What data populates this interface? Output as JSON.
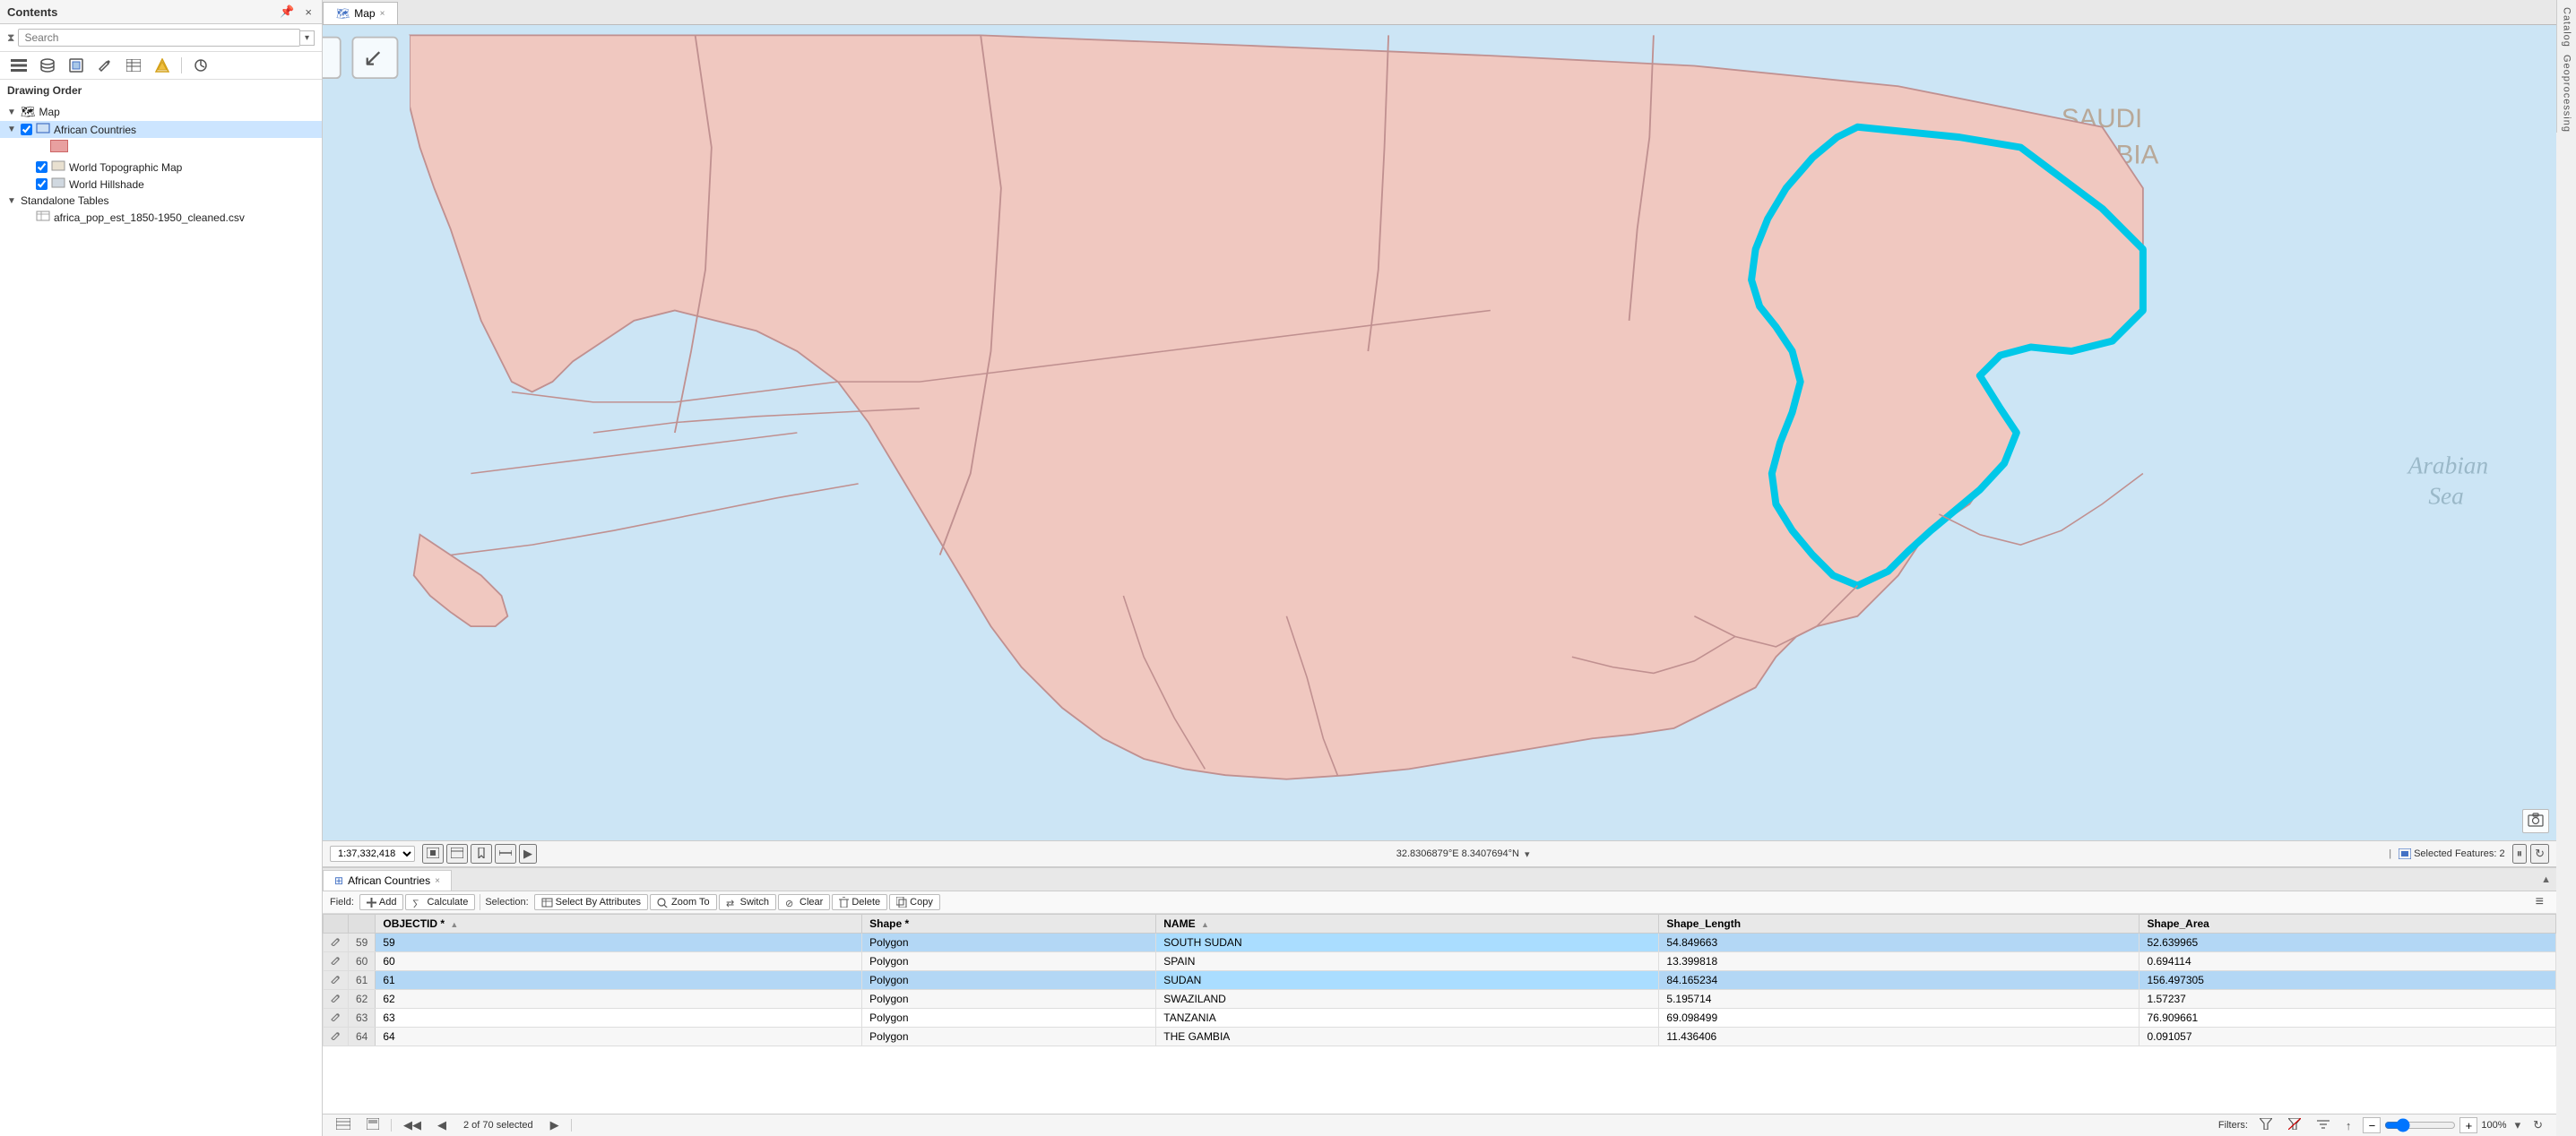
{
  "contents": {
    "title": "Contents",
    "search_placeholder": "Search",
    "drawing_order_label": "Drawing Order",
    "layers": [
      {
        "id": "map",
        "label": "Map",
        "type": "map",
        "indent": 0,
        "expanded": true
      },
      {
        "id": "african-countries",
        "label": "African Countries",
        "type": "feature",
        "indent": 1,
        "checked": true,
        "selected": true
      },
      {
        "id": "world-topographic-map",
        "label": "World Topographic Map",
        "type": "basemap",
        "indent": 2,
        "checked": true
      },
      {
        "id": "world-hillshade",
        "label": "World Hillshade",
        "type": "basemap",
        "indent": 2,
        "checked": true
      }
    ],
    "standalone_tables_label": "Standalone Tables",
    "tables": [
      {
        "id": "csv-table",
        "label": "africa_pop_est_1850-1950_cleaned.csv",
        "type": "table"
      }
    ]
  },
  "map_tab": {
    "label": "Map",
    "icon": "map-icon"
  },
  "map_view": {
    "scale": "1:37,332,418",
    "coordinates": "32.8306879°E 8.3407694°N",
    "selected_features": "Selected Features: 2"
  },
  "attribute_table": {
    "tab_label": "African Countries",
    "toolbar": {
      "field_label": "Field:",
      "add_label": "Add",
      "calculate_label": "Calculate",
      "selection_label": "Selection:",
      "select_by_attributes_label": "Select By Attributes",
      "zoom_to_label": "Zoom To",
      "switch_label": "Switch",
      "clear_label": "Clear",
      "delete_label": "Delete",
      "copy_label": "Copy"
    },
    "columns": [
      "OBJECTID *",
      "Shape *",
      "NAME",
      "Shape_Length",
      "Shape_Area"
    ],
    "rows": [
      {
        "row_num": 59,
        "objectid": 59,
        "shape": "Polygon",
        "name": "SOUTH SUDAN",
        "shape_length": "54.849663",
        "shape_area": "52.639965",
        "selected": true
      },
      {
        "row_num": 60,
        "objectid": 60,
        "shape": "Polygon",
        "name": "SPAIN",
        "shape_length": "13.399818",
        "shape_area": "0.694114",
        "selected": false
      },
      {
        "row_num": 61,
        "objectid": 61,
        "shape": "Polygon",
        "name": "SUDAN",
        "shape_length": "84.165234",
        "shape_area": "156.497305",
        "selected": true
      },
      {
        "row_num": 62,
        "objectid": 62,
        "shape": "Polygon",
        "name": "SWAZILAND",
        "shape_length": "5.195714",
        "shape_area": "1.57237",
        "selected": false
      },
      {
        "row_num": 63,
        "objectid": 63,
        "shape": "Polygon",
        "name": "TANZANIA",
        "shape_length": "69.098499",
        "shape_area": "76.909661",
        "selected": false
      },
      {
        "row_num": 64,
        "objectid": 64,
        "shape": "Polygon",
        "name": "THE GAMBIA",
        "shape_length": "11.436406",
        "shape_area": "0.091057",
        "selected": false
      }
    ],
    "status": {
      "selected_count": "2 of 70 selected",
      "filters_label": "Filters:",
      "zoom_level": "100%"
    }
  },
  "sidebar": {
    "catalog_label": "Catalog",
    "geoprocessing_label": "Geoprocessing"
  },
  "icons": {
    "filter": "⧗",
    "search": "🔍",
    "chevron_down": "▾",
    "chevron_right": "▶",
    "map": "🗺",
    "table_icon": "⊞",
    "add": "+",
    "edit_pencil": "✏",
    "grid": "⊞",
    "star": "★",
    "tag": "🏷",
    "paint": "🎨",
    "wrench": "🔧",
    "close": "×",
    "menu_dots": "⋮",
    "prev": "◀",
    "next": "▶",
    "first": "◀◀",
    "last": "▶▶"
  }
}
